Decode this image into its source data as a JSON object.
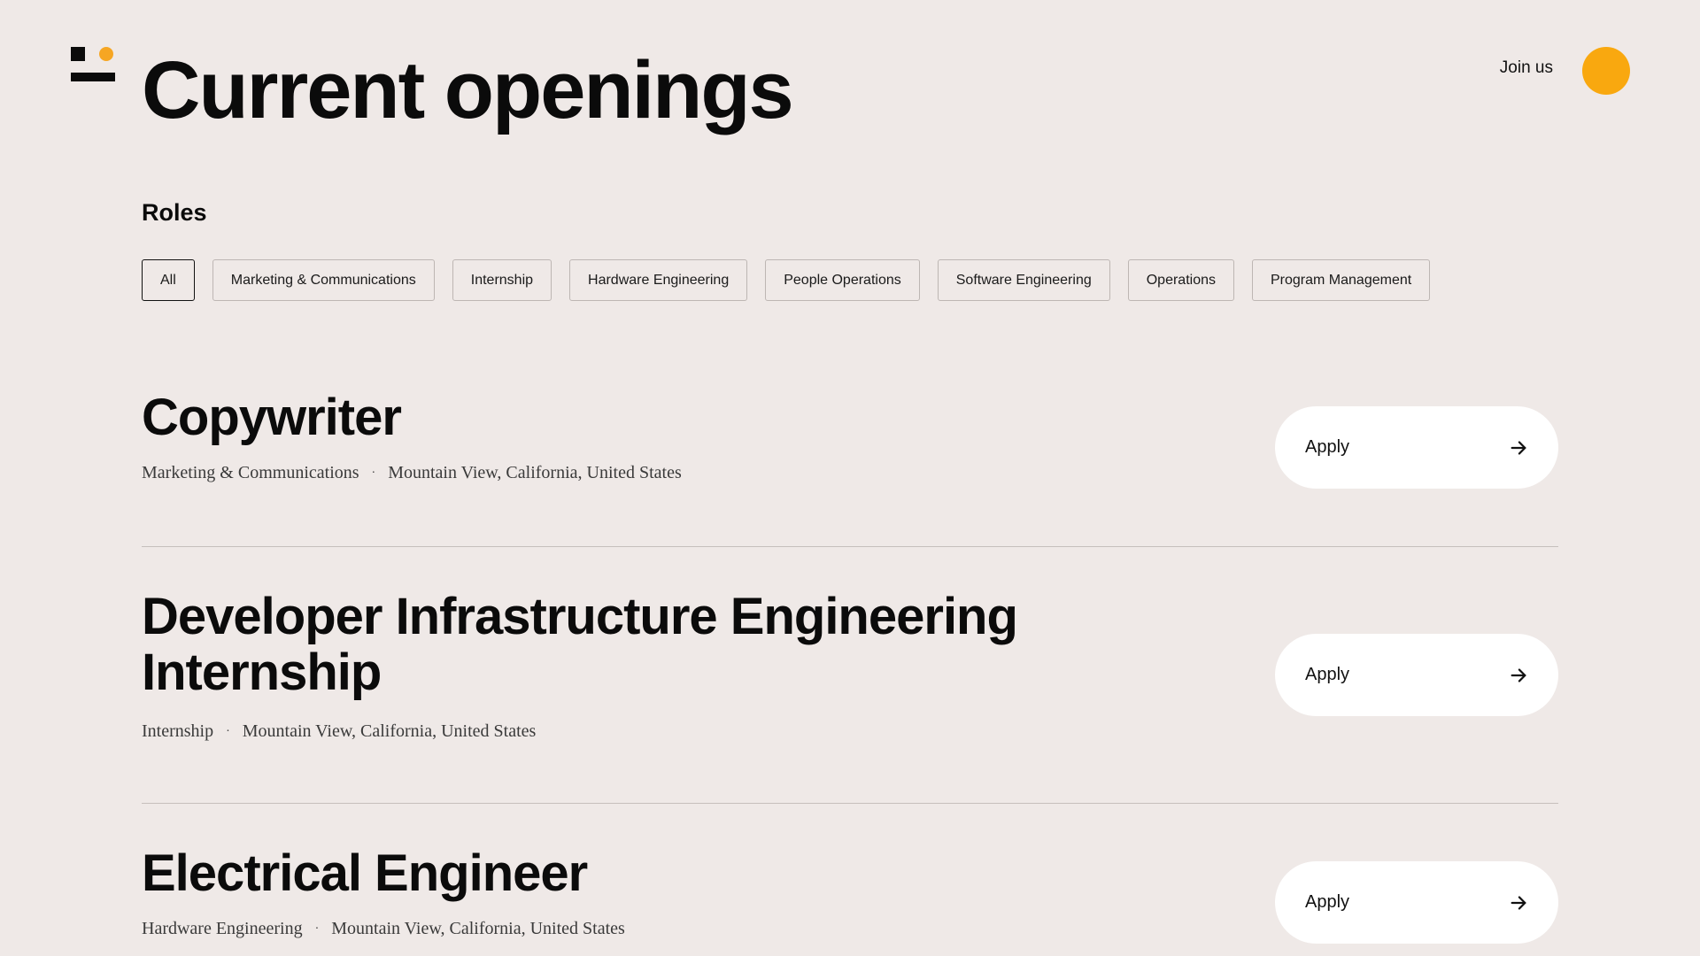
{
  "header": {
    "title": "Current openings",
    "join_label": "Join us",
    "accent_color": "#f9a80f"
  },
  "roles": {
    "heading": "Roles",
    "filters": [
      "All",
      "Marketing & Communications",
      "Internship",
      "Hardware Engineering",
      "People Operations",
      "Software Engineering",
      "Operations",
      "Program Management"
    ],
    "selected": "All"
  },
  "jobs": [
    {
      "title": "Copywriter",
      "department": "Marketing & Communications",
      "location": "Mountain View, California, United States",
      "apply_label": "Apply",
      "apply_icon": "arrow-right-icon"
    },
    {
      "title": "Developer Infrastructure Engineering Internship",
      "department": "Internship",
      "location": "Mountain View, California, United States",
      "apply_label": "Apply",
      "apply_icon": "arrow-right-icon"
    },
    {
      "title": "Electrical Engineer",
      "department": "Hardware Engineering",
      "location": "Mountain View, California, United States",
      "apply_label": "Apply",
      "apply_icon": "arrow-right-icon"
    }
  ]
}
